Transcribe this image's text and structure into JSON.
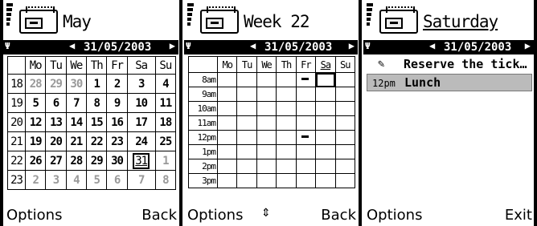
{
  "panel_month": {
    "title": "May",
    "date": "31/05/2003",
    "weekday_headers": [
      "Mo",
      "Tu",
      "We",
      "Th",
      "Fr",
      "Sa",
      "Su"
    ],
    "weeks": [
      {
        "wk": "18",
        "days": [
          [
            "28",
            "o"
          ],
          [
            "29",
            "o"
          ],
          [
            "30",
            "o"
          ],
          [
            "1",
            "d"
          ],
          [
            "2",
            "d"
          ],
          [
            "3",
            "d"
          ],
          [
            "4",
            "d"
          ]
        ]
      },
      {
        "wk": "19",
        "days": [
          [
            "5",
            "d"
          ],
          [
            "6",
            "d"
          ],
          [
            "7",
            "d"
          ],
          [
            "8",
            "d"
          ],
          [
            "9",
            "d"
          ],
          [
            "10",
            "d"
          ],
          [
            "11",
            "d"
          ]
        ]
      },
      {
        "wk": "20",
        "days": [
          [
            "12",
            "d"
          ],
          [
            "13",
            "d"
          ],
          [
            "14",
            "d"
          ],
          [
            "15",
            "d"
          ],
          [
            "16",
            "d"
          ],
          [
            "17",
            "d"
          ],
          [
            "18",
            "d"
          ]
        ]
      },
      {
        "wk": "21",
        "days": [
          [
            "19",
            "d"
          ],
          [
            "20",
            "d"
          ],
          [
            "21",
            "d"
          ],
          [
            "22",
            "d"
          ],
          [
            "23",
            "d"
          ],
          [
            "24",
            "d"
          ],
          [
            "25",
            "d"
          ]
        ]
      },
      {
        "wk": "22",
        "days": [
          [
            "26",
            "d"
          ],
          [
            "27",
            "d"
          ],
          [
            "28",
            "d"
          ],
          [
            "29",
            "d"
          ],
          [
            "30",
            "d"
          ],
          [
            "31",
            "today"
          ],
          [
            "1",
            "o"
          ]
        ]
      },
      {
        "wk": "23",
        "days": [
          [
            "2",
            "o"
          ],
          [
            "3",
            "o"
          ],
          [
            "4",
            "o"
          ],
          [
            "5",
            "o"
          ],
          [
            "6",
            "o"
          ],
          [
            "7",
            "o"
          ],
          [
            "8",
            "o"
          ]
        ]
      }
    ],
    "softkey_left": "Options",
    "softkey_right": "Back"
  },
  "panel_week": {
    "title": "Week 22",
    "date": "31/05/2003",
    "weekday_headers": [
      "Mo",
      "Tu",
      "We",
      "Th",
      "Fr",
      "Sa",
      "Su"
    ],
    "hours": [
      "8am",
      "9am",
      "10am",
      "11am",
      "12pm",
      "1pm",
      "2pm",
      "3pm"
    ],
    "softkey_left": "Options",
    "softkey_middle": "⇕",
    "softkey_right": "Back"
  },
  "panel_day": {
    "title": "Saturday",
    "date": "31/05/2003",
    "entries": [
      {
        "icon": "✎",
        "time": "",
        "text": "Reserve the tick…"
      },
      {
        "icon": "",
        "time": "12pm",
        "text": "Lunch"
      }
    ],
    "softkey_left": "Options",
    "softkey_right": "Exit"
  },
  "icons": {
    "antenna": "Ψ",
    "arrow_left": "◀",
    "arrow_right": "▶"
  }
}
